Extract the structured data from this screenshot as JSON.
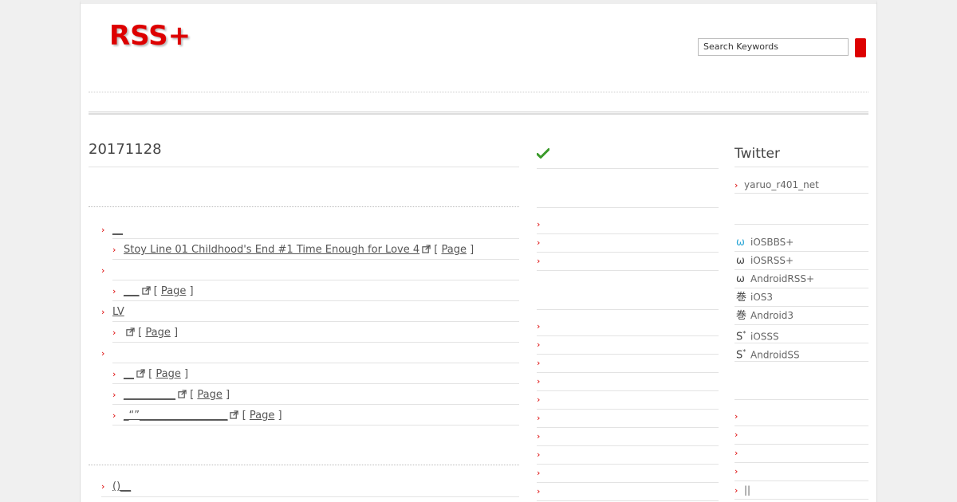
{
  "header": {
    "logo": "RSS+",
    "search_placeholder": "Search Keywords"
  },
  "main": {
    "date_heading": "20171128",
    "items": [
      {
        "level": 1,
        "text": "__"
      },
      {
        "level": 2,
        "text": "Stoy Line 01 Childhood's End #1 Time Enough for Love 4",
        "page": "Page"
      },
      {
        "level": 1,
        "text": ""
      },
      {
        "level": 2,
        "text": "___",
        "page": "Page"
      },
      {
        "level": 1,
        "text": "LV"
      },
      {
        "level": 2,
        "text": "",
        "page": "Page"
      },
      {
        "level": 1,
        "text": ""
      },
      {
        "level": 2,
        "text": "__",
        "page": "Page"
      },
      {
        "level": 2,
        "text": "__________",
        "page": "Page"
      },
      {
        "level": 2,
        "text": "_“”_________________",
        "page": "Page"
      }
    ],
    "second_group_first": "()__"
  },
  "right": {
    "twitter_title": "Twitter",
    "twitter_user": "yaruo_r401_net",
    "apps": [
      {
        "icon": "omega-icon",
        "glyph": "ω",
        "label": "iOSBBS+",
        "color": "#2aa6d6"
      },
      {
        "icon": "omega-icon",
        "glyph": "ω",
        "label": "iOSRSS+",
        "color": "#333333"
      },
      {
        "icon": "omega-icon",
        "glyph": "ω",
        "label": "AndroidRSS+",
        "color": "#333333"
      },
      {
        "icon": "kanji-icon",
        "glyph": "巻",
        "label": "iOS3",
        "color": "#333333"
      },
      {
        "icon": "kanji-icon",
        "glyph": "巻",
        "label": "Android3",
        "color": "#333333"
      },
      {
        "icon": "s-star-icon",
        "glyph": "S*",
        "label": "iOSSS",
        "color": "#333333"
      },
      {
        "icon": "s-star-icon",
        "glyph": "S*",
        "label": "AndroidSS",
        "color": "#333333"
      }
    ],
    "last_link": "||"
  },
  "colors": {
    "accent": "#dd0000",
    "check": "#3a9a2a"
  }
}
